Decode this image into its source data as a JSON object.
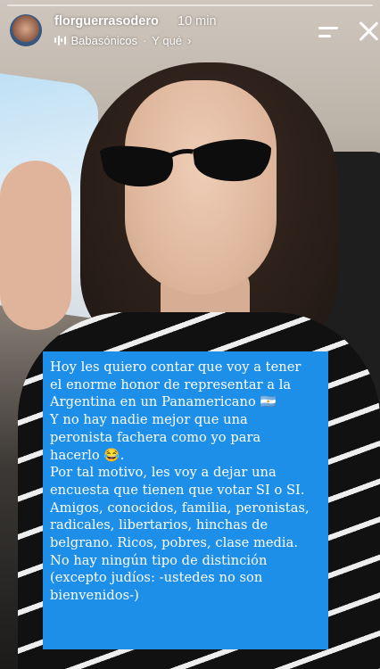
{
  "story": {
    "username": "florguerrasodero",
    "time_ago": "10 min",
    "music": {
      "artist": "Babasónicos",
      "separator": "·",
      "song": "Y qué",
      "chevron": "›"
    }
  },
  "caption": {
    "text": "Hoy les quiero contar que voy a tener\nel enorme honor de representar a la\nArgentina en un Panamericano 🇦🇷\nY no hay nadie mejor que una\nperonista fachera como yo para\nhacerlo 😂.\nPor tal motivo, les voy a dejar una\nencuesta que tienen que votar SI o SI.\nAmigos, conocidos, familia, peronistas,\nradicales, libertarios, hinchas de\nbelgrano. Ricos, pobres, clase media.\nNo hay ningún tipo de distinción\n(excepto judíos: -ustedes no son\nbienvenidos-)",
    "background_color": "#1e8fe8"
  },
  "icons": {
    "avatar": "profile-avatar",
    "music": "audio-waveform-icon",
    "menu": "menu-icon",
    "close": "close-icon"
  }
}
